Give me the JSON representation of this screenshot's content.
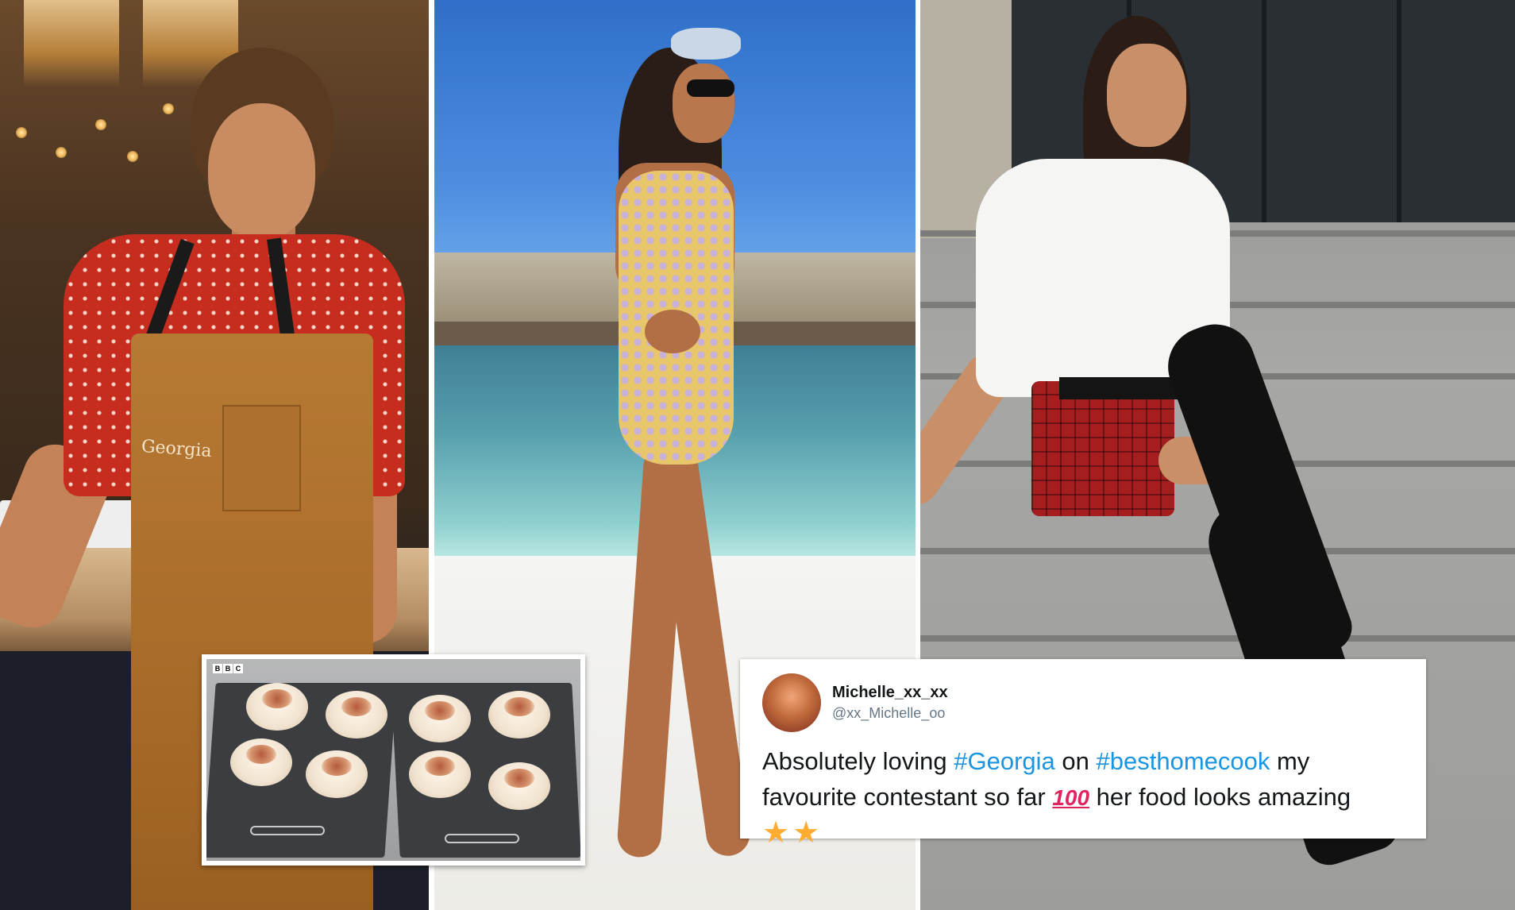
{
  "apron": {
    "name": "Georgia"
  },
  "dessert_inset": {
    "broadcaster_logo": [
      "B",
      "B",
      "C"
    ]
  },
  "tweet": {
    "display_name": "Michelle_xx_xx",
    "handle": "@xx_Michelle_oo",
    "text_part1": "Absolutely loving ",
    "hashtag1": "#Georgia",
    "text_part2": " on ",
    "hashtag2": "#besthomecook",
    "text_part3": " my favourite contestant so far ",
    "emoji_100": "100",
    "text_part4": " her food looks amazing",
    "stars": [
      "★",
      "★"
    ]
  },
  "colors": {
    "hashtag": "#1b95e0",
    "apron": "#a96b29",
    "blouse": "#c62d1f",
    "skirt": "#a41d1f"
  }
}
